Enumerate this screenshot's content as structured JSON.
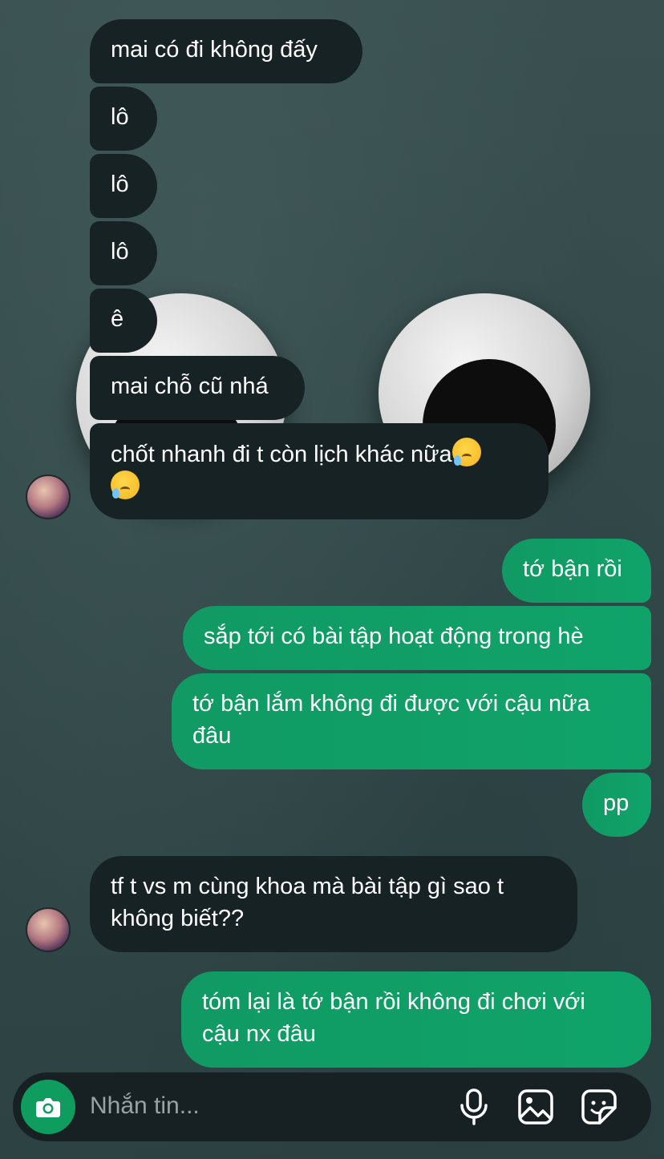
{
  "messages": [
    {
      "dir": "recv",
      "text": "mai có đi không đấy"
    },
    {
      "dir": "recv",
      "text": "lô"
    },
    {
      "dir": "recv",
      "text": "lô"
    },
    {
      "dir": "recv",
      "text": "lô"
    },
    {
      "dir": "recv",
      "text": "ê"
    },
    {
      "dir": "recv",
      "text": "mai chỗ cũ nhá"
    },
    {
      "dir": "recv",
      "text": "chốt nhanh đi t còn lịch khác nữa"
    },
    {
      "dir": "sent",
      "text": "tớ bận rồi"
    },
    {
      "dir": "sent",
      "text": "sắp tới có bài tập hoạt động trong hè"
    },
    {
      "dir": "sent",
      "text": "tớ bận lắm không đi được với cậu nữa"
    },
    {
      "dir": "sent",
      "text": "đâu"
    },
    {
      "dir": "sent",
      "text": "pp"
    },
    {
      "dir": "recv",
      "text": "tf t vs m cùng khoa mà bài tập gì sao t"
    },
    {
      "dir": "recv",
      "text": "không biết??"
    },
    {
      "dir": "sent",
      "text": "tóm lại là tớ bận rồi không đi chơi với"
    },
    {
      "dir": "sent",
      "text": "cậu nx đâu"
    }
  ],
  "emoji": [
    "crying-face-emoji",
    "crying-face-emoji"
  ],
  "composer": {
    "placeholder": "Nhắn tin...",
    "icons": [
      "camera-icon",
      "microphone-icon",
      "image-icon",
      "sticker-icon"
    ]
  },
  "colors": {
    "received_bubble": "#172224",
    "sent_bubble": "#0fa36a",
    "camera_button": "#0f9c5f"
  }
}
